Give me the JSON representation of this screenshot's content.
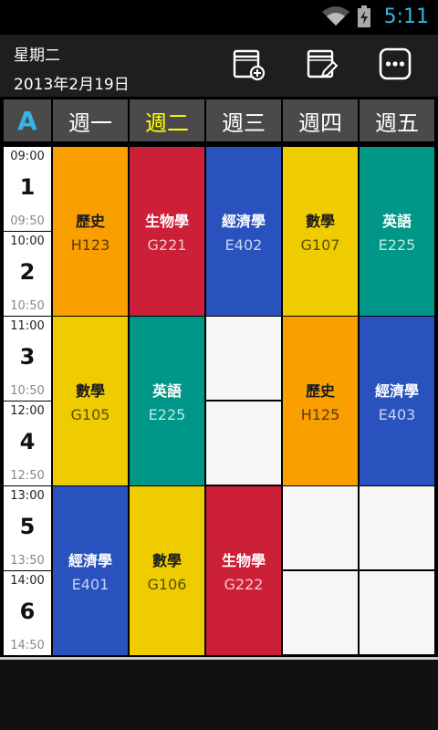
{
  "status": {
    "time": "5:11"
  },
  "header": {
    "weekday": "星期二",
    "date": "2013年2月19日"
  },
  "corner_label": "A",
  "days": [
    {
      "label": "週一",
      "today": false
    },
    {
      "label": "週二",
      "today": true
    },
    {
      "label": "週三",
      "today": false
    },
    {
      "label": "週四",
      "today": false
    },
    {
      "label": "週五",
      "today": false
    }
  ],
  "periods": [
    {
      "num": "1",
      "start": "09:00",
      "end": "09:50"
    },
    {
      "num": "2",
      "start": "10:00",
      "end": "10:50"
    },
    {
      "num": "3",
      "start": "11:00",
      "end": "10:50"
    },
    {
      "num": "4",
      "start": "12:00",
      "end": "12:50"
    },
    {
      "num": "5",
      "start": "13:00",
      "end": "13:50"
    },
    {
      "num": "6",
      "start": "14:00",
      "end": "14:50"
    }
  ],
  "classes": [
    {
      "day": 0,
      "from": 0,
      "span": 2,
      "name": "歷史",
      "room": "H123",
      "color": "#f99f00",
      "nameColor": "#1a1a1a",
      "roomColor": "#5a3a00"
    },
    {
      "day": 1,
      "from": 0,
      "span": 2,
      "name": "生物學",
      "room": "G221",
      "color": "#cc2038",
      "nameColor": "#ffffff",
      "roomColor": "#f3c6cc"
    },
    {
      "day": 2,
      "from": 0,
      "span": 2,
      "name": "經濟學",
      "room": "E402",
      "color": "#2a52be",
      "nameColor": "#ffffff",
      "roomColor": "#c7d3f5"
    },
    {
      "day": 3,
      "from": 0,
      "span": 2,
      "name": "數學",
      "room": "G107",
      "color": "#eecc00",
      "nameColor": "#1a1a1a",
      "roomColor": "#5a4e00"
    },
    {
      "day": 4,
      "from": 0,
      "span": 2,
      "name": "英語",
      "room": "E225",
      "color": "#009688",
      "nameColor": "#ffffff",
      "roomColor": "#bfe9e4"
    },
    {
      "day": 0,
      "from": 2,
      "span": 2,
      "name": "數學",
      "room": "G105",
      "color": "#eecc00",
      "nameColor": "#1a1a1a",
      "roomColor": "#5a4e00"
    },
    {
      "day": 1,
      "from": 2,
      "span": 2,
      "name": "英語",
      "room": "E225",
      "color": "#009688",
      "nameColor": "#ffffff",
      "roomColor": "#bfe9e4"
    },
    {
      "day": 3,
      "from": 2,
      "span": 2,
      "name": "歷史",
      "room": "H125",
      "color": "#f99f00",
      "nameColor": "#1a1a1a",
      "roomColor": "#5a3a00"
    },
    {
      "day": 4,
      "from": 2,
      "span": 2,
      "name": "經濟學",
      "room": "E403",
      "color": "#2a52be",
      "nameColor": "#ffffff",
      "roomColor": "#c7d3f5"
    },
    {
      "day": 0,
      "from": 4,
      "span": 2,
      "name": "經濟學",
      "room": "E401",
      "color": "#2a52be",
      "nameColor": "#ffffff",
      "roomColor": "#c7d3f5"
    },
    {
      "day": 1,
      "from": 4,
      "span": 2,
      "name": "數學",
      "room": "G106",
      "color": "#eecc00",
      "nameColor": "#1a1a1a",
      "roomColor": "#5a4e00"
    },
    {
      "day": 2,
      "from": 4,
      "span": 2,
      "name": "生物學",
      "room": "G222",
      "color": "#cc2038",
      "nameColor": "#ffffff",
      "roomColor": "#f3c6cc"
    }
  ],
  "empty_slots": [
    {
      "day": 2,
      "period": 2
    },
    {
      "day": 2,
      "period": 3
    },
    {
      "day": 3,
      "period": 4
    },
    {
      "day": 3,
      "period": 5
    },
    {
      "day": 4,
      "period": 4
    },
    {
      "day": 4,
      "period": 5
    }
  ],
  "icons": {
    "add": "calendar-add-icon",
    "edit": "calendar-edit-icon",
    "more": "more-options-icon"
  }
}
